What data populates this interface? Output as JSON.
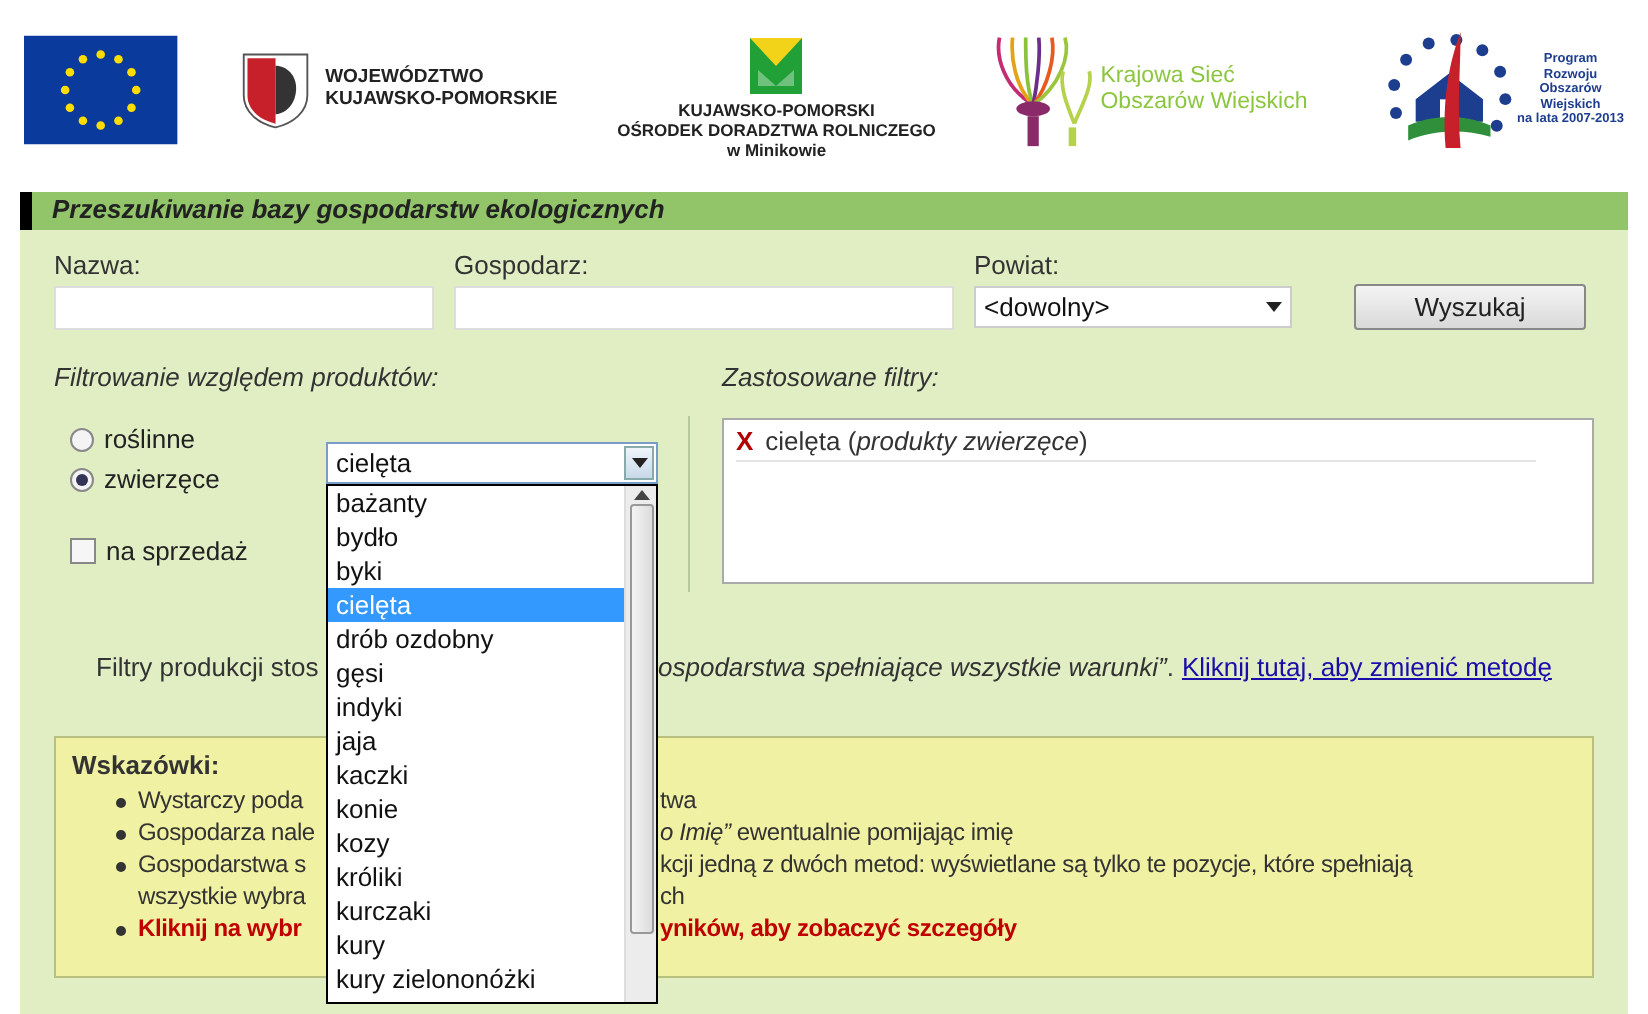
{
  "logos": {
    "region": [
      "WOJEWÓDZTWO",
      "KUJAWSKO-POMORSKIE"
    ],
    "center": [
      "KUJAWSKO-POMORSKI",
      "OŚRODEK DORADZTWA ROLNICZEGO",
      "w Minikowie"
    ],
    "network": [
      "Krajowa Sieć",
      "Obszarów Wiejskich"
    ],
    "program": [
      "Program",
      "Rozwoju",
      "Obszarów",
      "Wiejskich",
      "na lata 2007-2013"
    ]
  },
  "title": "Przeszukiwanie bazy gospodarstw ekologicznych",
  "fields": [
    {
      "label": "Nazwa:",
      "kind": "text"
    },
    {
      "label": "Gospodarz:",
      "kind": "text"
    },
    {
      "label": "Powiat:",
      "kind": "select",
      "value": "<dowolny>"
    }
  ],
  "search_button": "Wyszukaj",
  "filter_heading": "Filtrowanie względem produktów:",
  "product_types": [
    {
      "label": "roślinne",
      "selected": false
    },
    {
      "label": "zwierzęce",
      "selected": true
    }
  ],
  "for_sale": {
    "label": "na sprzedaż",
    "checked": false
  },
  "product_select": {
    "value": "cielęta",
    "expanded": true,
    "options": [
      {
        "label": "bażanty",
        "selected": false
      },
      {
        "label": "bydło",
        "selected": false
      },
      {
        "label": "byki",
        "selected": false
      },
      {
        "label": "cielęta",
        "selected": true
      },
      {
        "label": "drób ozdobny",
        "selected": false
      },
      {
        "label": "gęsi",
        "selected": false
      },
      {
        "label": "indyki",
        "selected": false
      },
      {
        "label": "jaja",
        "selected": false
      },
      {
        "label": "kaczki",
        "selected": false
      },
      {
        "label": "konie",
        "selected": false
      },
      {
        "label": "kozy",
        "selected": false
      },
      {
        "label": "króliki",
        "selected": false
      },
      {
        "label": "kurczaki",
        "selected": false
      },
      {
        "label": "kury",
        "selected": false
      },
      {
        "label": "kury zielononóżki",
        "selected": false
      }
    ]
  },
  "applied_heading": "Zastosowane filtry:",
  "applied_filters": [
    {
      "remove": "X",
      "text": "cielęta (*produkty zwierzęce*)"
    }
  ],
  "method_note": {
    "left": "Filtry produkcji stos",
    "right": "*ospodarstwa spełniające wszystkie warunki”*.",
    "link": "Kliknij tutaj, aby zmienić metodę"
  },
  "hints": {
    "title": "Wskazówki:",
    "items": [
      {
        "kind": "normal",
        "lines": [
          {
            "left": "Wystarczy poda",
            "right": "twa"
          }
        ]
      },
      {
        "kind": "normal",
        "lines": [
          {
            "left": "Gospodarza nale",
            "right": "*o Imię”* ewentualnie pomijając imię"
          }
        ]
      },
      {
        "kind": "normal",
        "lines": [
          {
            "left": "Gospodarstwa s",
            "right": "kcji jedną z dwóch metod: wyświetlane są tylko te pozycje, które spełniają"
          },
          {
            "left": "wszystkie wybra",
            "right": "ch"
          }
        ]
      },
      {
        "kind": "alert",
        "lines": [
          {
            "left": "Kliknij na wybr",
            "right": "yników, aby zobaczyć szczegóły"
          }
        ]
      }
    ]
  }
}
